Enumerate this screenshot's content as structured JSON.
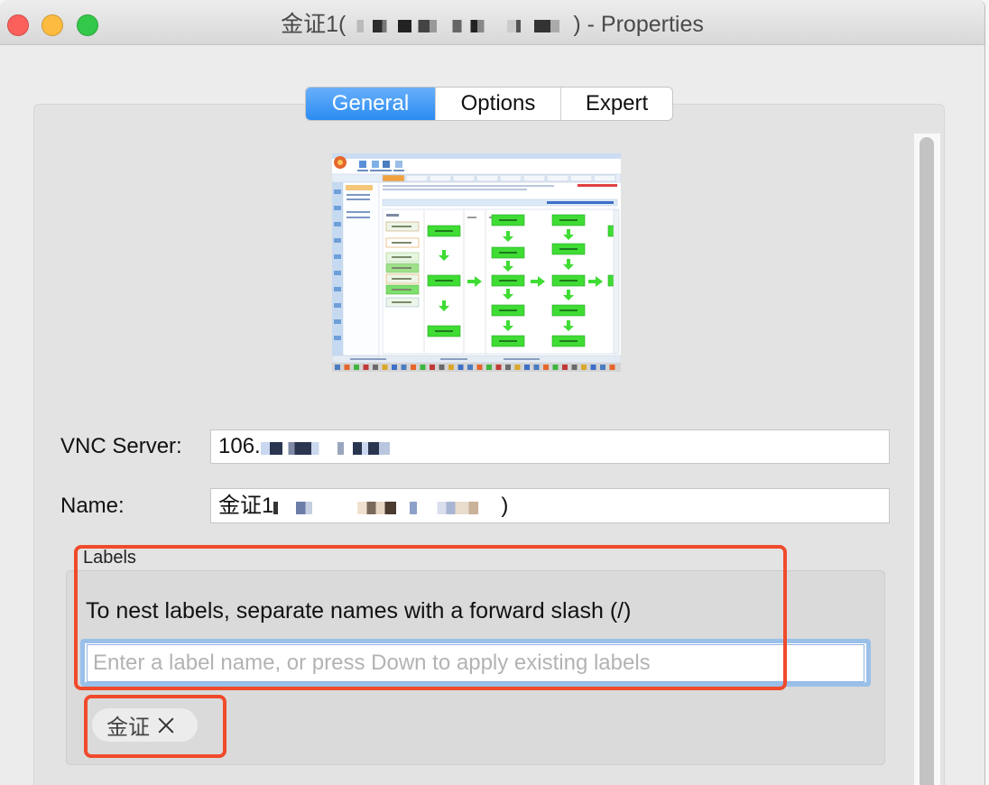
{
  "window": {
    "title_prefix": "金证1(",
    "title_suffix": ") - Properties",
    "traffic_lights": [
      {
        "icon": "close-window-icon",
        "color": "#fc605b"
      },
      {
        "icon": "minimize-window-icon",
        "color": "#fdbc40"
      },
      {
        "icon": "zoom-window-icon",
        "color": "#34c84a"
      }
    ]
  },
  "tabs": [
    {
      "label": "General",
      "selected": true
    },
    {
      "label": "Options",
      "selected": false
    },
    {
      "label": "Expert",
      "selected": false
    }
  ],
  "general": {
    "vnc_server": {
      "label": "VNC Server:",
      "value_visible": "106."
    },
    "name": {
      "label": "Name:",
      "value_prefix": "金证1",
      "value_suffix": ")"
    },
    "labels": {
      "group_title": "Labels",
      "hint": "To nest labels, separate names with a forward slash (/)",
      "input_value": "",
      "input_placeholder": "Enter a label name, or press Down to apply existing labels",
      "tags": [
        {
          "label": "金证",
          "remove_icon": "close-icon"
        }
      ]
    }
  },
  "colors": {
    "accent": "#2a8cf2",
    "focus_ring": "#9ac0ea",
    "annotation": "#f04a2c",
    "flow_green": "#3fdc34"
  }
}
